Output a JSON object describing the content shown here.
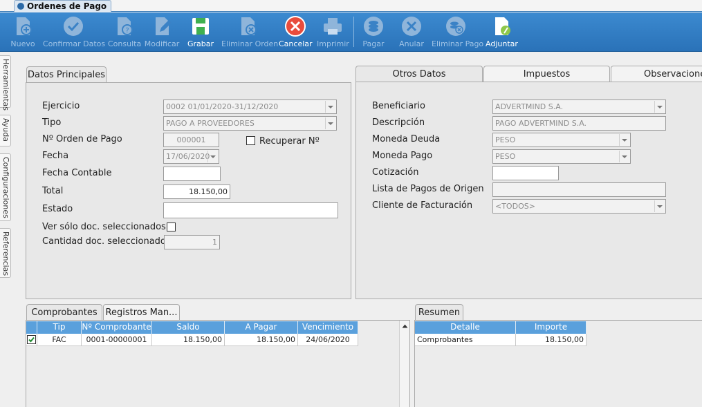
{
  "window": {
    "tab_title": "Ordenes de Pago"
  },
  "toolbar": {
    "buttons": [
      {
        "label": "Nuevo",
        "icon": "new-doc-icon",
        "enabled": false
      },
      {
        "label": "Confirmar Datos",
        "icon": "check-icon",
        "enabled": false
      },
      {
        "label": "Consulta",
        "icon": "query-doc-icon",
        "enabled": false
      },
      {
        "label": "Modificar",
        "icon": "edit-doc-icon",
        "enabled": false
      },
      {
        "label": "Grabar",
        "icon": "save-icon",
        "enabled": true
      },
      {
        "label": "Eliminar Orden",
        "icon": "delete-doc-icon",
        "enabled": false
      },
      {
        "label": "Cancelar",
        "icon": "cancel-icon",
        "enabled": true
      },
      {
        "label": "Imprimir",
        "icon": "printer-icon",
        "enabled": false
      },
      {
        "label": "Pagar",
        "icon": "pay-coins-icon",
        "enabled": false
      },
      {
        "label": "Anular",
        "icon": "void-icon",
        "enabled": false
      },
      {
        "label": "Eliminar Pago",
        "icon": "delete-payment-icon",
        "enabled": false
      },
      {
        "label": "Adjuntar",
        "icon": "attach-icon",
        "enabled": true
      }
    ]
  },
  "side_tabs": [
    "Herramientas",
    "Ayuda",
    "Configuraciones",
    "Referencias"
  ],
  "main_panel": {
    "tab": "Datos Principales",
    "labels": {
      "ejercicio": "Ejercicio",
      "tipo": "Tipo",
      "nro_orden": "Nº Orden de Pago",
      "recuperar": "Recuperar Nº",
      "fecha": "Fecha",
      "fecha_contable": "Fecha Contable",
      "total": "Total",
      "estado": "Estado",
      "ver_solo": "Ver sólo doc. seleccionados",
      "cantidad": "Cantidad doc. seleccionados"
    },
    "values": {
      "ejercicio": "0002 01/01/2020-31/12/2020",
      "tipo": "PAGO A PROVEEDORES",
      "nro_orden": "000001",
      "fecha": "17/06/2020",
      "fecha_contable": "",
      "total": "18.150,00",
      "estado": "",
      "cantidad": "1"
    }
  },
  "other_panel": {
    "tabs": [
      "Otros Datos",
      "Impuestos",
      "Observaciones"
    ],
    "labels": {
      "beneficiario": "Beneficiario",
      "descripcion": "Descripción",
      "moneda_deuda": "Moneda Deuda",
      "moneda_pago": "Moneda Pago",
      "cotizacion": "Cotización",
      "lista_pagos": "Lista de Pagos de Origen",
      "cliente_fact": "Cliente de Facturación"
    },
    "values": {
      "beneficiario": "ADVERTMIND S.A.",
      "descripcion": "PAGO ADVERTMIND S.A.",
      "moneda_deuda": "PESO",
      "moneda_pago": "PESO",
      "cotizacion": "",
      "lista_pagos": "",
      "cliente_fact": "<TODOS>"
    }
  },
  "comprobantes": {
    "tabs": [
      "Comprobantes",
      "Registros Man..."
    ],
    "columns": [
      "Tip",
      "Nº Comprobante",
      "Saldo",
      "A Pagar",
      "Vencimiento"
    ],
    "rows": [
      {
        "checked": true,
        "tip": "FAC",
        "nro": "0001-00000001",
        "saldo": "18.150,00",
        "a_pagar": "18.150,00",
        "vencimiento": "24/06/2020"
      }
    ]
  },
  "resumen": {
    "tab": "Resumen",
    "columns": [
      "Detalle",
      "Importe"
    ],
    "rows": [
      {
        "detalle": "Comprobantes",
        "importe": "18.150,00"
      }
    ]
  },
  "colors": {
    "toolbar": "#2f7ac2",
    "grid_header": "#5aa0dc"
  }
}
